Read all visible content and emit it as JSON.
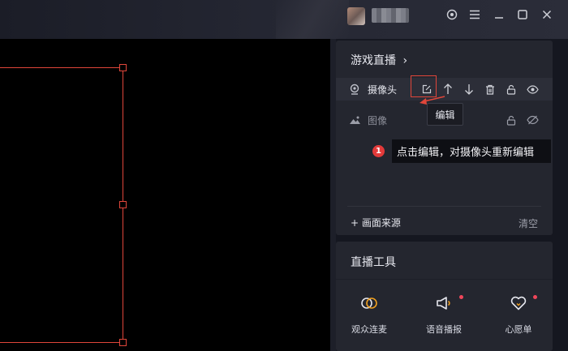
{
  "colors": {
    "accent_red": "#e0463a",
    "panel_bg": "#24262f",
    "text": "#d8dae3"
  },
  "titlebar": {
    "icons": [
      "settings-icon",
      "menu-icon",
      "minimize-icon",
      "maximize-icon",
      "close-icon"
    ]
  },
  "scene_panel": {
    "title": "游戏直播",
    "sources": [
      {
        "name": "摄像头",
        "icon": "camera-icon",
        "active": true
      },
      {
        "name": "图像",
        "icon": "image-icon",
        "active": false
      }
    ],
    "tooltip": "编辑",
    "annotation": {
      "number": "1",
      "text": "点击编辑，对摄像头重新编辑"
    },
    "add_source": "+ 画面来源",
    "clear": "清空"
  },
  "tools_panel": {
    "title": "直播工具",
    "tools": [
      {
        "label": "观众连麦",
        "icon": "co-stream-icon",
        "badge": false
      },
      {
        "label": "语音播报",
        "icon": "voice-broadcast-icon",
        "badge": true
      },
      {
        "label": "心愿单",
        "icon": "wishlist-heart-icon",
        "badge": true
      }
    ]
  }
}
